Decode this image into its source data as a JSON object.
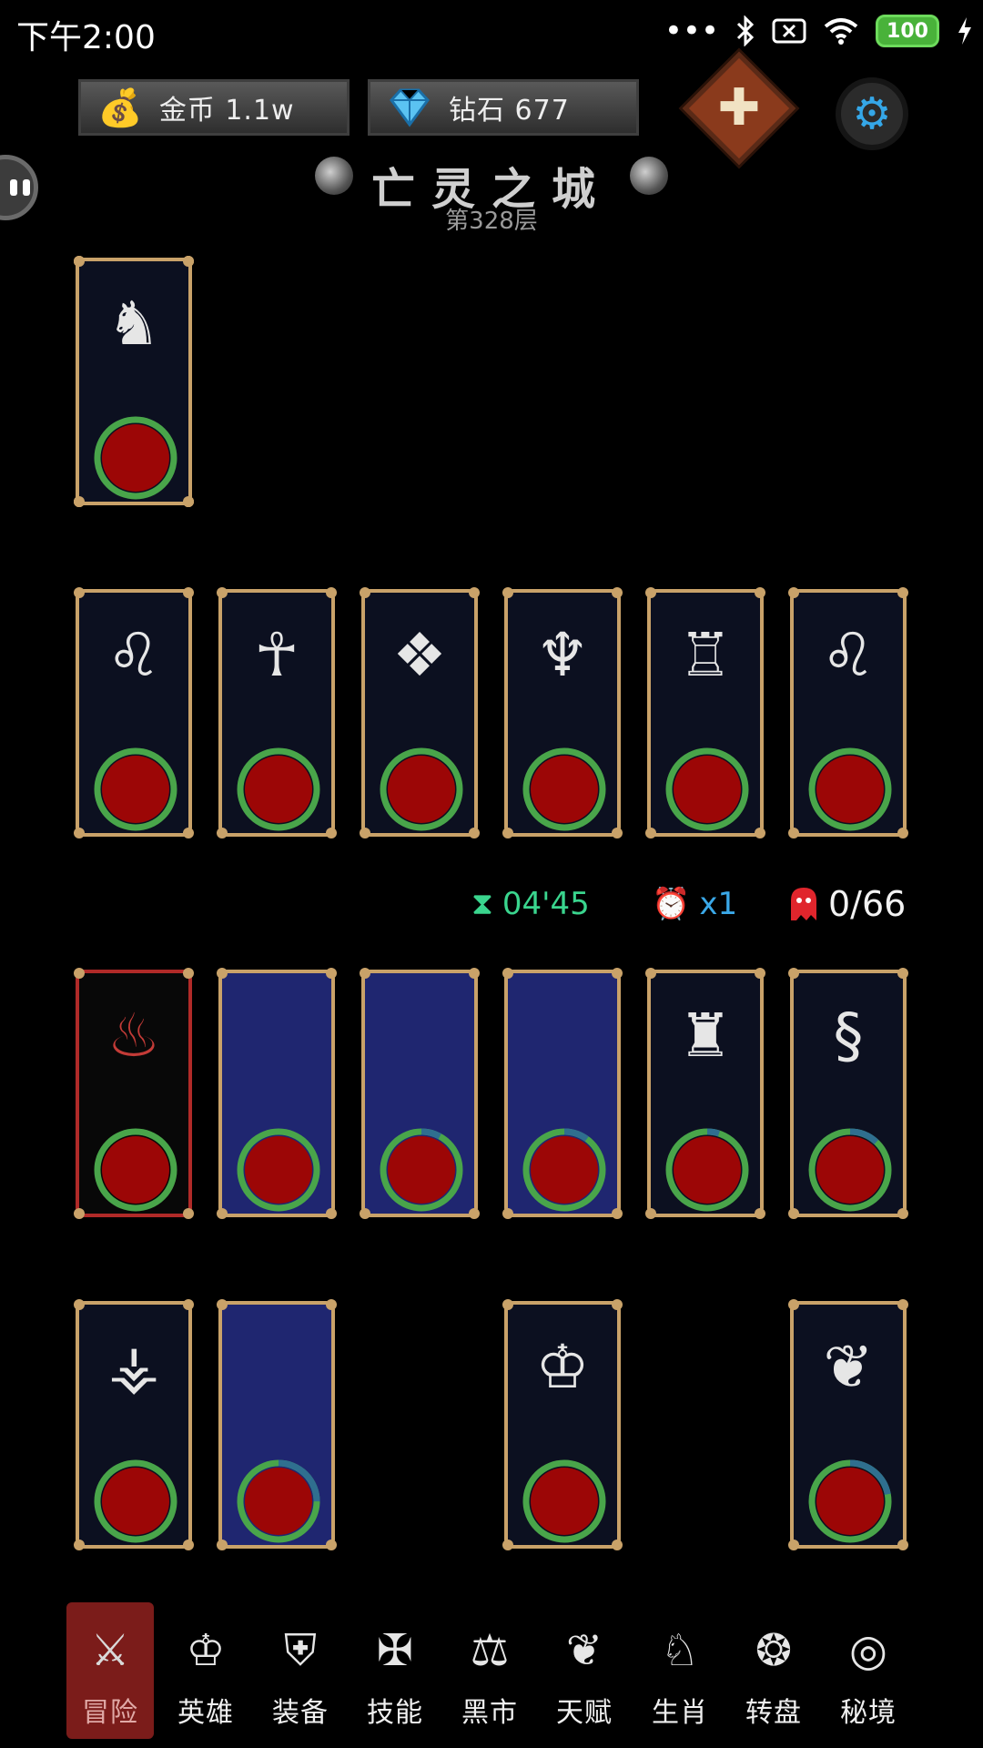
{
  "status_bar": {
    "time": "下午2:00",
    "battery": "100",
    "icons": [
      "more-dots-icon",
      "bluetooth-icon",
      "sim-off-icon",
      "wifi-icon",
      "battery-icon",
      "charging-icon"
    ]
  },
  "resources": {
    "gold_label": "金币 1.1w",
    "diamond_label": "钻石 677"
  },
  "actions": {
    "add_icon": "plus-icon",
    "settings_icon": "gear-icon"
  },
  "level": {
    "title": "亡灵之城",
    "floor": "第328层"
  },
  "hud": {
    "timer": "04'45",
    "speed": "x1",
    "kills": "0/66"
  },
  "enemy_cards": [
    {
      "emblem": "demon-icon",
      "glyph": "☠",
      "style": "purple",
      "progress": 0.12
    },
    {
      "emblem": "scorpion-icon",
      "glyph": "♏",
      "style": "white",
      "progress": 0.0
    },
    {
      "emblem": "lion-icon",
      "glyph": "♌",
      "style": "purple",
      "progress": 0.08
    },
    {
      "emblem": "qilin-icon",
      "glyph": "♞",
      "style": "white",
      "progress": 0.0
    },
    {
      "emblem": "lion-icon",
      "glyph": "♌",
      "style": "white",
      "progress": 0.0
    },
    {
      "emblem": "mage-icon",
      "glyph": "☥",
      "style": "white",
      "progress": 0.0
    },
    {
      "emblem": "beast-mask-icon",
      "glyph": "❖",
      "style": "white",
      "progress": 0.0
    },
    {
      "emblem": "dragon-icon",
      "glyph": "♆",
      "style": "white",
      "progress": 0.0
    },
    {
      "emblem": "mummy-icon",
      "glyph": "♖",
      "style": "white",
      "progress": 0.0
    },
    {
      "emblem": "lion-icon",
      "glyph": "♌",
      "style": "white",
      "progress": 0.0
    }
  ],
  "hero_cards": [
    {
      "emblem": "flame-icon",
      "glyph": "♨",
      "style": "red",
      "progress": 0.0
    },
    {
      "emblem": "empty-slot",
      "glyph": "",
      "style": "blue",
      "progress": 0.0
    },
    {
      "emblem": "empty-slot",
      "glyph": "",
      "style": "blue",
      "progress": 0.08
    },
    {
      "emblem": "empty-slot",
      "glyph": "",
      "style": "blue",
      "progress": 0.1
    },
    {
      "emblem": "knight-icon",
      "glyph": "♜",
      "style": "dark",
      "progress": 0.05
    },
    {
      "emblem": "serpent-icon",
      "glyph": "§",
      "style": "dark",
      "progress": 0.12
    },
    {
      "emblem": "hooded-sage-icon",
      "glyph": "⚶",
      "style": "dark",
      "progress": 0.0
    },
    {
      "emblem": "empty-slot",
      "glyph": "",
      "style": "blue",
      "progress": 0.25
    },
    {
      "emblem": "warrior-helm-icon",
      "glyph": "♔",
      "style": "dark",
      "progress": 0.0
    },
    {
      "emblem": "rabbit-icon",
      "glyph": "❦",
      "style": "dark",
      "progress": 0.22
    }
  ],
  "bottom_nav": [
    {
      "label": "冒险",
      "icon": "crossed-swords-icon",
      "glyph": "⚔"
    },
    {
      "label": "英雄",
      "icon": "hero-icon",
      "glyph": "♔"
    },
    {
      "label": "装备",
      "icon": "shield-icon",
      "glyph": "⛨"
    },
    {
      "label": "技能",
      "icon": "spellbook-icon",
      "glyph": "✠"
    },
    {
      "label": "黑市",
      "icon": "scales-icon",
      "glyph": "⚖"
    },
    {
      "label": "天赋",
      "icon": "tree-icon",
      "glyph": "❦"
    },
    {
      "label": "生肖",
      "icon": "wolf-icon",
      "glyph": "♘"
    },
    {
      "label": "转盘",
      "icon": "wheel-icon",
      "glyph": "❂"
    },
    {
      "label": "秘境",
      "icon": "vortex-icon",
      "glyph": "◎"
    }
  ],
  "colors": {
    "card_border": "#c9a269",
    "ring_green": "#49a54a",
    "ring_blue": "#2f6f8f",
    "core_red": "#9c0606",
    "timer": "#3ad58e",
    "speed": "#3aa8e8",
    "kills_icon": "#e0252c"
  }
}
